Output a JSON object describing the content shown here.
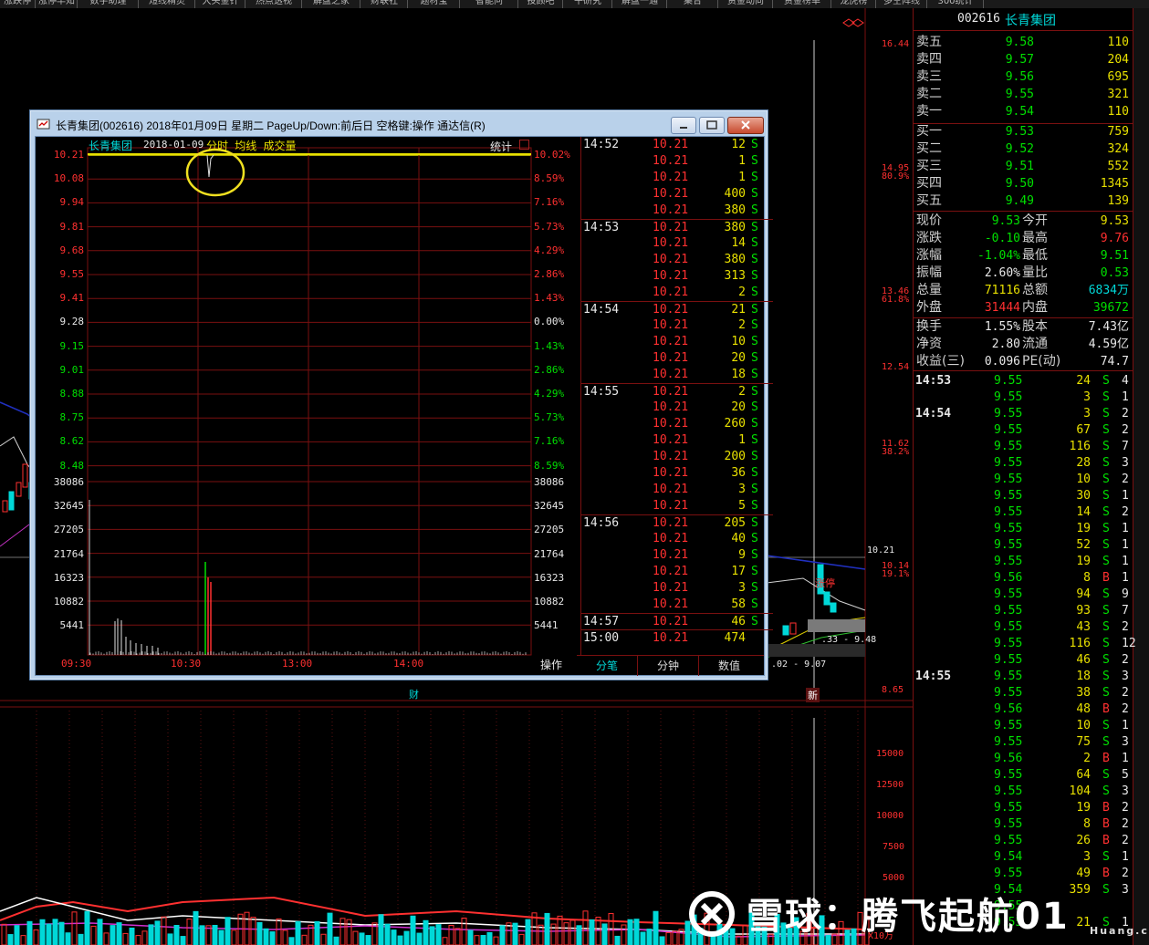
{
  "toolbar": {
    "items": [
      "涨跌停",
      "涨停早知",
      "数字助理",
      "短线精灵",
      "大头金针",
      "热点透视",
      "解盘之家",
      "财联社",
      "题材宝",
      "智能问",
      "投顾吧",
      "午研究",
      "解盘一通",
      "集合",
      "资金动向",
      "资金榜单",
      "龙虎榜",
      "多空阵线",
      "300统计"
    ]
  },
  "bg_chart": {
    "price_axis": [
      "16.44",
      "14.95",
      "80.9%",
      "13.46",
      "61.8%",
      "12.54",
      "11.62",
      "38.2%",
      "10.21",
      "10.14",
      "19.1%",
      "8.65"
    ],
    "volume_axis": [
      "15000",
      "12500",
      "10000",
      "7500",
      "5000",
      "X10万"
    ],
    "markers": {
      "cai": "财",
      "xin": "新",
      "zhangting": "涨停"
    },
    "mini_labels": {
      "range1": ".33 - 9.48",
      "range2": ".02 - 9.07"
    }
  },
  "dialog": {
    "title": "长青集团(002616) 2018年01月09日 星期二 PageUp/Down:前后日 空格键:操作 通达信(R)",
    "header": {
      "name": "长青集团",
      "date": "2018-01-09",
      "mode": "分时 均线 成交量",
      "stat": "统计"
    },
    "price_ticks": [
      "10.21",
      "10.08",
      "9.94",
      "9.81",
      "9.68",
      "9.55",
      "9.41",
      "9.28",
      "9.15",
      "9.01",
      "8.88",
      "8.75",
      "8.62",
      "8.48"
    ],
    "pct_ticks": [
      "10.02%",
      "8.59%",
      "7.16%",
      "5.73%",
      "4.29%",
      "2.86%",
      "1.43%",
      "0.00%",
      "1.43%",
      "2.86%",
      "4.29%",
      "5.73%",
      "7.16%",
      "8.59%"
    ],
    "vol_ticks": [
      "38086",
      "32645",
      "27205",
      "21764",
      "16323",
      "10882",
      "5441"
    ],
    "time_ticks": [
      "09:30",
      "10:30",
      "13:00",
      "14:00"
    ],
    "action_label": "操作",
    "tabs": [
      "分笔",
      "分钟",
      "数值"
    ],
    "ticks": [
      {
        "t": "14:52",
        "p": "10.21",
        "v": "12",
        "s": "S"
      },
      {
        "t": "",
        "p": "10.21",
        "v": "1",
        "s": "S"
      },
      {
        "t": "",
        "p": "10.21",
        "v": "1",
        "s": "S"
      },
      {
        "t": "",
        "p": "10.21",
        "v": "400",
        "s": "S"
      },
      {
        "t": "",
        "p": "10.21",
        "v": "380",
        "s": "S"
      },
      {
        "t": "14:53",
        "p": "10.21",
        "v": "380",
        "s": "S"
      },
      {
        "t": "",
        "p": "10.21",
        "v": "14",
        "s": "S"
      },
      {
        "t": "",
        "p": "10.21",
        "v": "380",
        "s": "S"
      },
      {
        "t": "",
        "p": "10.21",
        "v": "313",
        "s": "S"
      },
      {
        "t": "",
        "p": "10.21",
        "v": "2",
        "s": "S"
      },
      {
        "t": "14:54",
        "p": "10.21",
        "v": "21",
        "s": "S"
      },
      {
        "t": "",
        "p": "10.21",
        "v": "2",
        "s": "S"
      },
      {
        "t": "",
        "p": "10.21",
        "v": "10",
        "s": "S"
      },
      {
        "t": "",
        "p": "10.21",
        "v": "20",
        "s": "S"
      },
      {
        "t": "",
        "p": "10.21",
        "v": "18",
        "s": "S"
      },
      {
        "t": "14:55",
        "p": "10.21",
        "v": "2",
        "s": "S"
      },
      {
        "t": "",
        "p": "10.21",
        "v": "20",
        "s": "S"
      },
      {
        "t": "",
        "p": "10.21",
        "v": "260",
        "s": "S"
      },
      {
        "t": "",
        "p": "10.21",
        "v": "1",
        "s": "S"
      },
      {
        "t": "",
        "p": "10.21",
        "v": "200",
        "s": "S"
      },
      {
        "t": "",
        "p": "10.21",
        "v": "36",
        "s": "S"
      },
      {
        "t": "",
        "p": "10.21",
        "v": "3",
        "s": "S"
      },
      {
        "t": "",
        "p": "10.21",
        "v": "5",
        "s": "S"
      },
      {
        "t": "14:56",
        "p": "10.21",
        "v": "205",
        "s": "S"
      },
      {
        "t": "",
        "p": "10.21",
        "v": "40",
        "s": "S"
      },
      {
        "t": "",
        "p": "10.21",
        "v": "9",
        "s": "S"
      },
      {
        "t": "",
        "p": "10.21",
        "v": "17",
        "s": "S"
      },
      {
        "t": "",
        "p": "10.21",
        "v": "3",
        "s": "S"
      },
      {
        "t": "",
        "p": "10.21",
        "v": "58",
        "s": "S"
      },
      {
        "t": "14:57",
        "p": "10.21",
        "v": "46",
        "s": "S"
      },
      {
        "t": "15:00",
        "p": "10.21",
        "v": "474",
        "s": ""
      }
    ]
  },
  "quote": {
    "code": "002616",
    "name": "长青集团",
    "sell": [
      {
        "label": "卖五",
        "price": "9.58",
        "vol": "110"
      },
      {
        "label": "卖四",
        "price": "9.57",
        "vol": "204"
      },
      {
        "label": "卖三",
        "price": "9.56",
        "vol": "695"
      },
      {
        "label": "卖二",
        "price": "9.55",
        "vol": "321"
      },
      {
        "label": "卖一",
        "price": "9.54",
        "vol": "110"
      }
    ],
    "buy": [
      {
        "label": "买一",
        "price": "9.53",
        "vol": "759"
      },
      {
        "label": "买二",
        "price": "9.52",
        "vol": "324"
      },
      {
        "label": "买三",
        "price": "9.51",
        "vol": "552"
      },
      {
        "label": "买四",
        "price": "9.50",
        "vol": "1345"
      },
      {
        "label": "买五",
        "price": "9.49",
        "vol": "139"
      }
    ],
    "stats": [
      {
        "l1": "现价",
        "v1": "9.53",
        "l2": "今开",
        "v2": "9.53"
      },
      {
        "l1": "涨跌",
        "v1": "-0.10",
        "l2": "最高",
        "v2": "9.76"
      },
      {
        "l1": "涨幅",
        "v1": "-1.04%",
        "l2": "最低",
        "v2": "9.51"
      },
      {
        "l1": "振幅",
        "v1": "2.60%",
        "l2": "量比",
        "v2": "0.53"
      },
      {
        "l1": "总量",
        "v1": "71116",
        "l2": "总额",
        "v2": "6834万"
      },
      {
        "l1": "外盘",
        "v1": "31444",
        "l2": "内盘",
        "v2": "39672"
      },
      {
        "l1": "换手",
        "v1": "1.55%",
        "l2": "股本",
        "v2": "7.43亿"
      },
      {
        "l1": "净资",
        "v1": "2.80",
        "l2": "流通",
        "v2": "4.59亿"
      },
      {
        "l1": "收益(三)",
        "v1": "0.096",
        "l2": "PE(动)",
        "v2": "74.7"
      }
    ],
    "trades": [
      {
        "t": "14:53",
        "p": "9.55",
        "v": "24",
        "s": "S",
        "n": "4"
      },
      {
        "t": "",
        "p": "9.55",
        "v": "3",
        "s": "S",
        "n": "1"
      },
      {
        "t": "14:54",
        "p": "9.55",
        "v": "3",
        "s": "S",
        "n": "2"
      },
      {
        "t": "",
        "p": "9.55",
        "v": "67",
        "s": "S",
        "n": "2"
      },
      {
        "t": "",
        "p": "9.55",
        "v": "116",
        "s": "S",
        "n": "7"
      },
      {
        "t": "",
        "p": "9.55",
        "v": "28",
        "s": "S",
        "n": "3"
      },
      {
        "t": "",
        "p": "9.55",
        "v": "10",
        "s": "S",
        "n": "2"
      },
      {
        "t": "",
        "p": "9.55",
        "v": "30",
        "s": "S",
        "n": "1"
      },
      {
        "t": "",
        "p": "9.55",
        "v": "14",
        "s": "S",
        "n": "2"
      },
      {
        "t": "",
        "p": "9.55",
        "v": "19",
        "s": "S",
        "n": "1"
      },
      {
        "t": "",
        "p": "9.55",
        "v": "52",
        "s": "S",
        "n": "1"
      },
      {
        "t": "",
        "p": "9.55",
        "v": "19",
        "s": "S",
        "n": "1"
      },
      {
        "t": "",
        "p": "9.56",
        "v": "8",
        "s": "B",
        "n": "1"
      },
      {
        "t": "",
        "p": "9.55",
        "v": "94",
        "s": "S",
        "n": "9"
      },
      {
        "t": "",
        "p": "9.55",
        "v": "93",
        "s": "S",
        "n": "7"
      },
      {
        "t": "",
        "p": "9.55",
        "v": "43",
        "s": "S",
        "n": "2"
      },
      {
        "t": "",
        "p": "9.55",
        "v": "116",
        "s": "S",
        "n": "12"
      },
      {
        "t": "",
        "p": "9.55",
        "v": "46",
        "s": "S",
        "n": "2"
      },
      {
        "t": "14:55",
        "p": "9.55",
        "v": "18",
        "s": "S",
        "n": "3"
      },
      {
        "t": "",
        "p": "9.55",
        "v": "38",
        "s": "S",
        "n": "2"
      },
      {
        "t": "",
        "p": "9.56",
        "v": "48",
        "s": "B",
        "n": "2"
      },
      {
        "t": "",
        "p": "9.55",
        "v": "10",
        "s": "S",
        "n": "1"
      },
      {
        "t": "",
        "p": "9.55",
        "v": "75",
        "s": "S",
        "n": "3"
      },
      {
        "t": "",
        "p": "9.56",
        "v": "2",
        "s": "B",
        "n": "1"
      },
      {
        "t": "",
        "p": "9.55",
        "v": "64",
        "s": "S",
        "n": "5"
      },
      {
        "t": "",
        "p": "9.55",
        "v": "104",
        "s": "S",
        "n": "3"
      },
      {
        "t": "",
        "p": "9.55",
        "v": "19",
        "s": "B",
        "n": "2"
      },
      {
        "t": "",
        "p": "9.55",
        "v": "8",
        "s": "B",
        "n": "2"
      },
      {
        "t": "",
        "p": "9.55",
        "v": "26",
        "s": "B",
        "n": "2"
      },
      {
        "t": "",
        "p": "9.54",
        "v": "3",
        "s": "S",
        "n": "1"
      },
      {
        "t": "",
        "p": "9.55",
        "v": "49",
        "s": "B",
        "n": "2"
      },
      {
        "t": "",
        "p": "9.54",
        "v": "359",
        "s": "S",
        "n": "3"
      },
      {
        "t": "",
        "p": "9.55",
        "v": "",
        "s": "",
        "n": ""
      },
      {
        "t": "",
        "p": "9.55",
        "v": "21",
        "s": "S",
        "n": "1"
      }
    ]
  },
  "watermark": {
    "text": "雪球：腾飞起航01",
    "site": "Huang.cn"
  },
  "colors": {
    "up": "#ff3030",
    "down": "#00e000",
    "grid": "#7a1010",
    "avg": "#e8e000"
  }
}
